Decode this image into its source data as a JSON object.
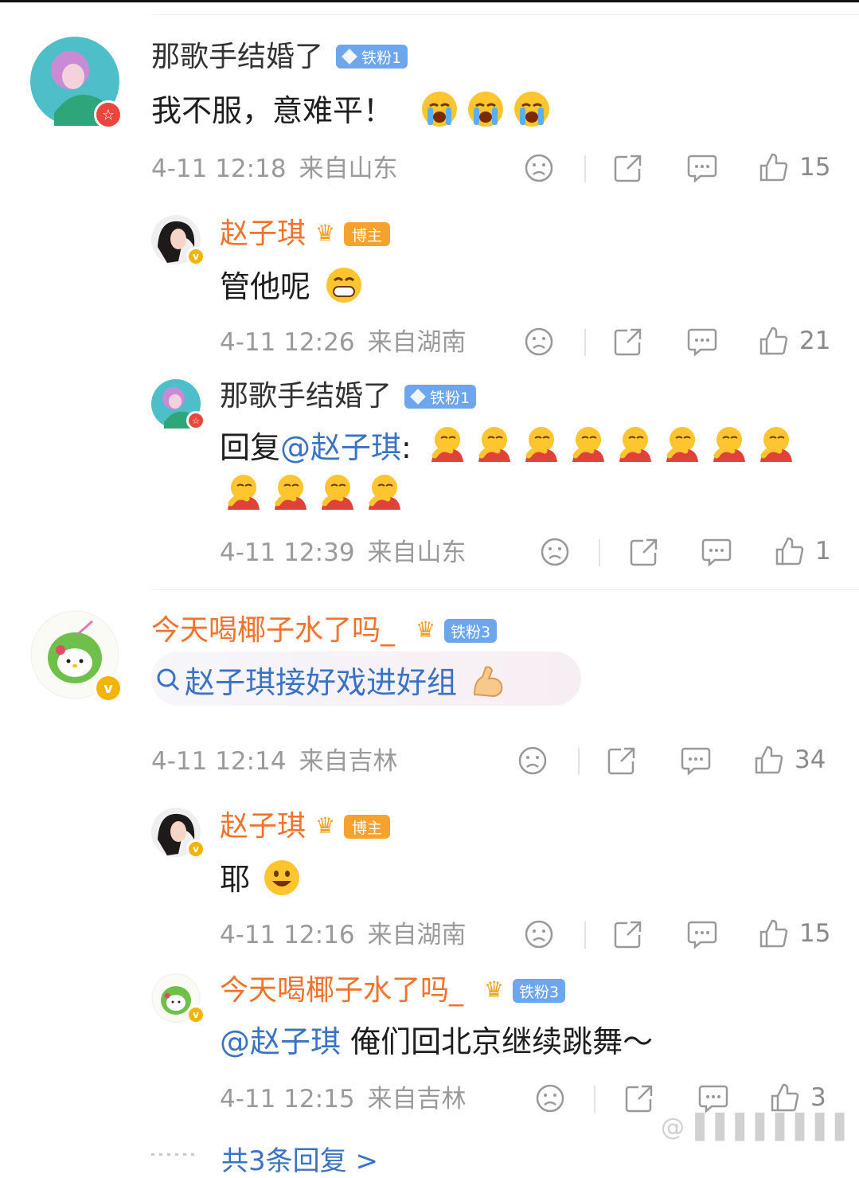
{
  "comments": [
    {
      "user": "那歌手结婚了",
      "tag": "铁粉1",
      "text": "我不服，意难平！",
      "emoji": [
        "cry-emoji",
        "cry-emoji",
        "cry-emoji"
      ],
      "time": "4-11 12:18",
      "location": "来自山东",
      "likes": "15",
      "replies": [
        {
          "user": "赵子琪",
          "tag": "博主",
          "text": "管他呢",
          "emoji": [
            "grin-emoji"
          ],
          "time": "4-11 12:26",
          "location": "来自湖南",
          "likes": "21"
        },
        {
          "user": "那歌手结婚了",
          "tag": "铁粉1",
          "reply_prefix": "回复",
          "mention": "@赵子琪",
          "colon": ":",
          "emoji_count": 12,
          "time": "4-11 12:39",
          "location": "来自山东",
          "likes": "1"
        }
      ]
    },
    {
      "user": "今天喝椰子水了吗_",
      "tag": "铁粉3",
      "search_text": "赵子琪接好戏进好组",
      "emoji": [
        "muscle-emoji"
      ],
      "time": "4-11 12:14",
      "location": "来自吉林",
      "likes": "34",
      "replies": [
        {
          "user": "赵子琪",
          "tag": "博主",
          "text": "耶",
          "emoji": [
            "smile-emoji"
          ],
          "time": "4-11 12:16",
          "location": "来自湖南",
          "likes": "15"
        },
        {
          "user": "今天喝椰子水了吗_",
          "tag": "铁粉3",
          "mention": "@赵子琪",
          "text": "俺们回北京继续跳舞～",
          "time": "4-11 12:15",
          "location": "来自吉林",
          "likes": "3"
        }
      ],
      "more_replies": "共3条回复 >"
    }
  ],
  "colors": {
    "accent_orange": "#f0722b",
    "link_blue": "#3b73c4",
    "meta_gray": "#9a9a9a"
  }
}
